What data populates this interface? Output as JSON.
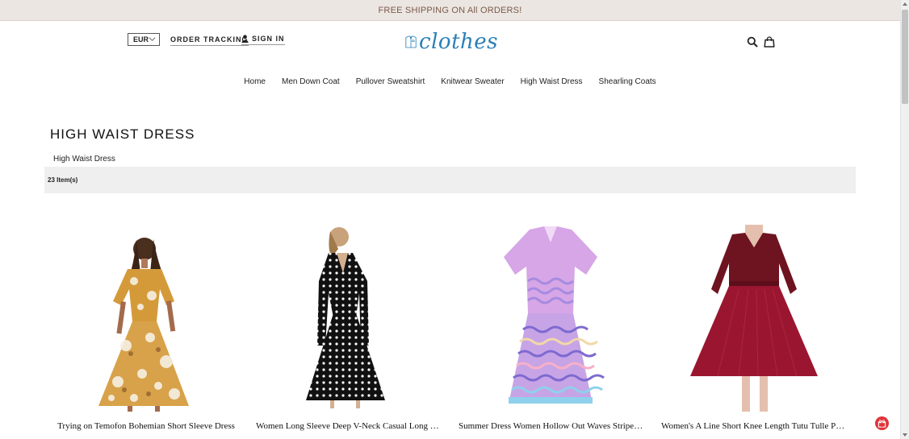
{
  "promo_bar": {
    "text": "FREE SHIPPING ON All ORDERS!"
  },
  "header": {
    "currency": "EUR",
    "order_tracking": "ORDER TRACKING",
    "sign_in": "SIGN IN",
    "logo_text": "clothes"
  },
  "nav": {
    "items": [
      "Home",
      "Men Down Coat",
      "Pullover Sweatshirt",
      "Knitwear Sweater",
      "High Waist Dress",
      "Shearling Coats"
    ]
  },
  "category": {
    "title": "HIGH WAIST DRESS",
    "subcategory": "High Waist Dress",
    "item_count": "23 Item(s)"
  },
  "products": [
    {
      "name": "Trying on Temofon Bohemian Short Sleeve Dress"
    },
    {
      "name": "Women Long Sleeve Deep V-Neck Casual Long Dress..."
    },
    {
      "name": "Summer Dress Women Hollow Out Waves Striped..."
    },
    {
      "name": "Women's A Line Short Knee Length Tutu Tulle Prom..."
    }
  ],
  "colors": {
    "accent": "#2a7fb8",
    "promo_bg": "#ece6e2",
    "price": "#c6294a",
    "badge": "#e0343b"
  }
}
